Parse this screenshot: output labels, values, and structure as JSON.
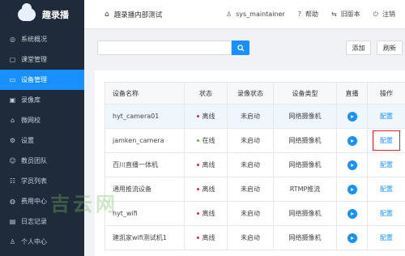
{
  "app": {
    "name": "趣录播"
  },
  "header": {
    "title": "趣录播内部测试",
    "user": "sys_maintainer",
    "help": "帮助",
    "old_version": "旧版本",
    "logout": "注销"
  },
  "sidebar": {
    "items": [
      {
        "label": "系统概况",
        "icon": "dashboard-icon",
        "active": false
      },
      {
        "label": "课堂管理",
        "icon": "classroom-icon",
        "active": false
      },
      {
        "label": "设备管理",
        "icon": "device-icon",
        "active": true
      },
      {
        "label": "录像库",
        "icon": "video-library-icon",
        "active": false
      },
      {
        "label": "微网校",
        "icon": "school-icon",
        "active": false
      },
      {
        "label": "设置",
        "icon": "settings-icon",
        "active": false
      },
      {
        "label": "教员团队",
        "icon": "team-icon",
        "active": false
      },
      {
        "label": "学员列表",
        "icon": "students-icon",
        "active": false
      },
      {
        "label": "费用中心",
        "icon": "billing-icon",
        "active": false
      },
      {
        "label": "日志记录",
        "icon": "log-icon",
        "active": false
      },
      {
        "label": "个人中心",
        "icon": "user-icon",
        "active": false
      }
    ]
  },
  "toolbar": {
    "search_placeholder": "",
    "add_label": "添加",
    "refresh_label": "刷新"
  },
  "table": {
    "headers": [
      "设备名称",
      "状态",
      "录像状态",
      "设备类型",
      "直播",
      "操作"
    ],
    "rows": [
      {
        "name": "hyt_camera01",
        "status": "离线",
        "online": false,
        "record": "未启动",
        "type": "网络摄像机",
        "action": "配置",
        "highlight": true
      },
      {
        "name": "jamken_camera",
        "status": "在线",
        "online": true,
        "record": "未启动",
        "type": "网络摄像机",
        "action": "配置",
        "boxed": true
      },
      {
        "name": "百川直播一体机",
        "status": "离线",
        "online": false,
        "record": "未启动",
        "type": "网络摄像机",
        "action": "配置"
      },
      {
        "name": "通用推流设备",
        "status": "离线",
        "online": false,
        "record": "未启动",
        "type": "RTMP推流",
        "action": "配置"
      },
      {
        "name": "hyt_wifi",
        "status": "离线",
        "online": false,
        "record": "未启动",
        "type": "网络摄像机",
        "action": "配置"
      },
      {
        "name": "建凯家wifi测试机1",
        "status": "离线",
        "online": false,
        "record": "未启动",
        "type": "网络摄像机",
        "action": "配置"
      }
    ]
  },
  "watermark": "吉云网",
  "colors": {
    "sidebar_bg": "#1f2b3a",
    "accent": "#1890ff",
    "offline": "#f5222d",
    "online": "#52c41a",
    "highlight_border": "#e0202a"
  }
}
